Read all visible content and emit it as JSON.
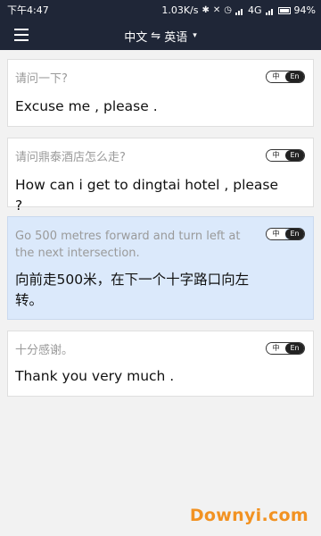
{
  "status_bar": {
    "time": "下午4:47",
    "speed": "1.03K/s",
    "network": "4G",
    "battery": "94%"
  },
  "app_bar": {
    "menu_icon": "hamburger-menu-icon",
    "source_lang": "中文",
    "swap_symbol": "⇋",
    "target_lang": "英语",
    "dropdown_icon": "caret-down-icon"
  },
  "cards": [
    {
      "source": "请问一下?",
      "translation": "Excuse me , please .",
      "toggle": {
        "zh": "中",
        "en": "En"
      }
    },
    {
      "source": "请问鼎泰酒店怎么走?",
      "translation": "How can i get to dingtai hotel , please ?",
      "toggle": {
        "zh": "中",
        "en": "En"
      }
    },
    {
      "source": "Go 500 metres forward and turn left at the next intersection.",
      "translation": "向前走500米，在下一个十字路口向左转。",
      "toggle": {
        "zh": "中",
        "en": "En"
      }
    },
    {
      "source": "十分感谢。",
      "translation": "Thank you very much .",
      "toggle": {
        "zh": "中",
        "en": "En"
      }
    }
  ],
  "watermark": "Downyi.com"
}
